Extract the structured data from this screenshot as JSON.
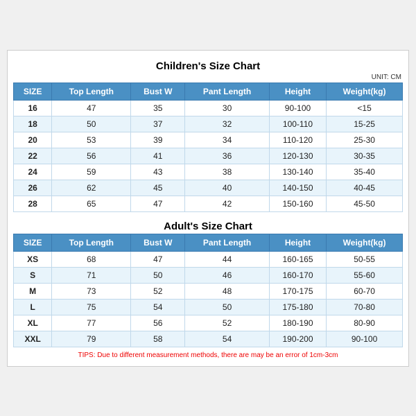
{
  "children": {
    "title": "Children's Size Chart",
    "unit": "UNIT: CM",
    "headers": [
      "SIZE",
      "Top Length",
      "Bust W",
      "Pant Length",
      "Height",
      "Weight(kg)"
    ],
    "rows": [
      [
        "16",
        "47",
        "35",
        "30",
        "90-100",
        "<15"
      ],
      [
        "18",
        "50",
        "37",
        "32",
        "100-110",
        "15-25"
      ],
      [
        "20",
        "53",
        "39",
        "34",
        "110-120",
        "25-30"
      ],
      [
        "22",
        "56",
        "41",
        "36",
        "120-130",
        "30-35"
      ],
      [
        "24",
        "59",
        "43",
        "38",
        "130-140",
        "35-40"
      ],
      [
        "26",
        "62",
        "45",
        "40",
        "140-150",
        "40-45"
      ],
      [
        "28",
        "65",
        "47",
        "42",
        "150-160",
        "45-50"
      ]
    ]
  },
  "adult": {
    "title": "Adult's Size Chart",
    "headers": [
      "SIZE",
      "Top Length",
      "Bust W",
      "Pant Length",
      "Height",
      "Weight(kg)"
    ],
    "rows": [
      [
        "XS",
        "68",
        "47",
        "44",
        "160-165",
        "50-55"
      ],
      [
        "S",
        "71",
        "50",
        "46",
        "160-170",
        "55-60"
      ],
      [
        "M",
        "73",
        "52",
        "48",
        "170-175",
        "60-70"
      ],
      [
        "L",
        "75",
        "54",
        "50",
        "175-180",
        "70-80"
      ],
      [
        "XL",
        "77",
        "56",
        "52",
        "180-190",
        "80-90"
      ],
      [
        "XXL",
        "79",
        "58",
        "54",
        "190-200",
        "90-100"
      ]
    ]
  },
  "tips": "TIPS: Due to different measurement methods, there are may be an error of 1cm-3cm"
}
